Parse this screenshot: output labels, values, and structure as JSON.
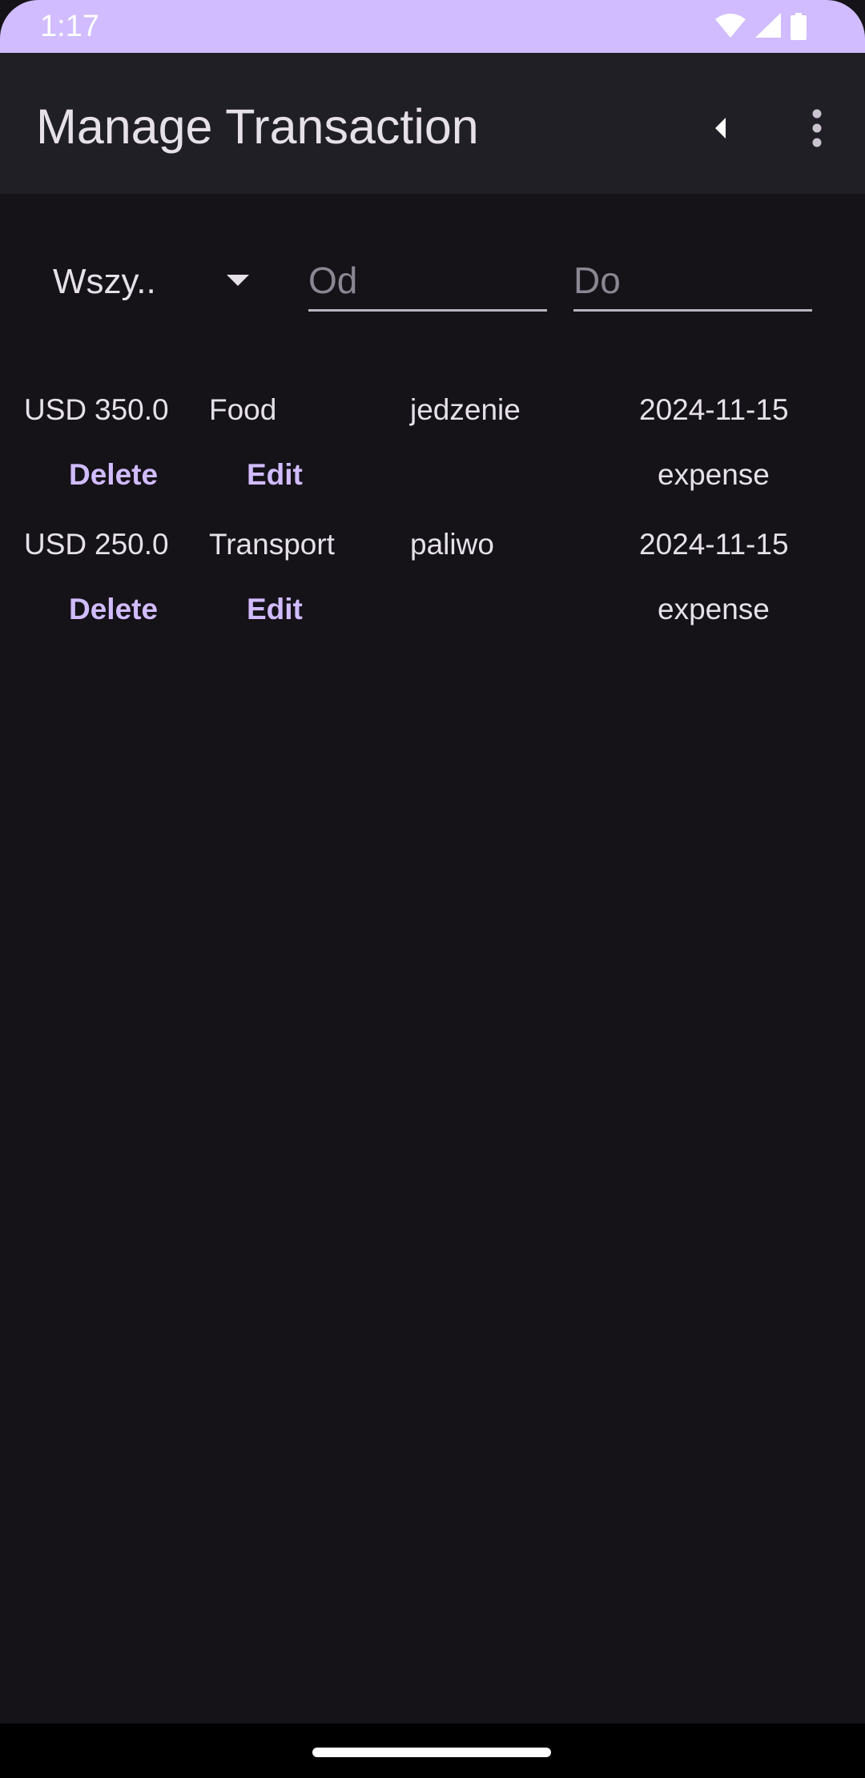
{
  "status_bar": {
    "time": "1:17",
    "icons": [
      "wifi-icon",
      "cellular-signal-icon",
      "battery-icon"
    ]
  },
  "app_bar": {
    "title": "Manage Transaction",
    "back_icon": "back-arrow-icon",
    "menu_icon": "more-vertical-icon"
  },
  "filters": {
    "type_dropdown": {
      "value": "Wszy..",
      "icon": "dropdown-arrow-icon"
    },
    "date_from": {
      "value": "",
      "placeholder": "Od"
    },
    "date_to": {
      "value": "",
      "placeholder": "Do"
    }
  },
  "transactions": [
    {
      "currency": "USD",
      "amount": "350.0",
      "category": "Food",
      "description": "jedzenie",
      "date": "2024-11-15",
      "type": "expense",
      "delete_label": "Delete",
      "edit_label": "Edit"
    },
    {
      "currency": "USD",
      "amount": "250.0",
      "category": "Transport",
      "description": "paliwo",
      "date": "2024-11-15",
      "type": "expense",
      "delete_label": "Delete",
      "edit_label": "Edit"
    }
  ],
  "colors": {
    "background": "#151218",
    "app_bar": "#211f26",
    "status_bar": "#d0bcff",
    "accent": "#d0bcff",
    "text": "#e6e0e9",
    "placeholder": "#8c8692"
  }
}
